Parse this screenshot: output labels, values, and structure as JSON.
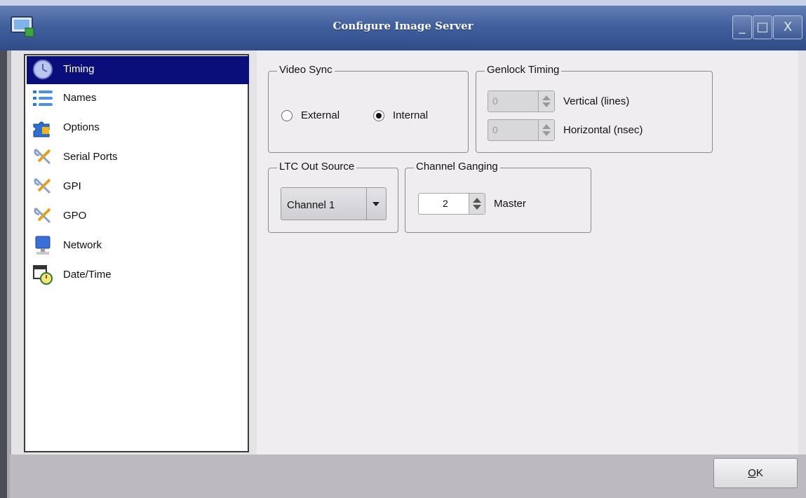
{
  "window": {
    "title": "Configure Image Server",
    "controls": {
      "minimize": "_",
      "maximize": "□",
      "close": "X"
    }
  },
  "sidebar": {
    "items": [
      {
        "label": "Timing",
        "icon": "clock-icon",
        "selected": true
      },
      {
        "label": "Names",
        "icon": "list-icon",
        "selected": false
      },
      {
        "label": "Options",
        "icon": "puzzle-icon",
        "selected": false
      },
      {
        "label": "Serial Ports",
        "icon": "tools-icon",
        "selected": false
      },
      {
        "label": "GPI",
        "icon": "tools-icon",
        "selected": false
      },
      {
        "label": "GPO",
        "icon": "tools-icon",
        "selected": false
      },
      {
        "label": "Network",
        "icon": "monitor-icon",
        "selected": false
      },
      {
        "label": "Date/Time",
        "icon": "calendar-clock-icon",
        "selected": false
      }
    ]
  },
  "video_sync": {
    "title": "Video Sync",
    "external_label": "External",
    "internal_label": "Internal",
    "selected": "Internal"
  },
  "genlock": {
    "title": "Genlock Timing",
    "vertical_value": "0",
    "vertical_label": "Vertical (lines)",
    "horizontal_value": "0",
    "horizontal_label": "Horizontal (nsec)"
  },
  "ltc": {
    "title": "LTC Out Source",
    "selected": "Channel 1"
  },
  "ganging": {
    "title": "Channel Ganging",
    "value": "2",
    "label": "Master"
  },
  "footer": {
    "ok_mnemonic": "O",
    "ok_rest": "K"
  }
}
